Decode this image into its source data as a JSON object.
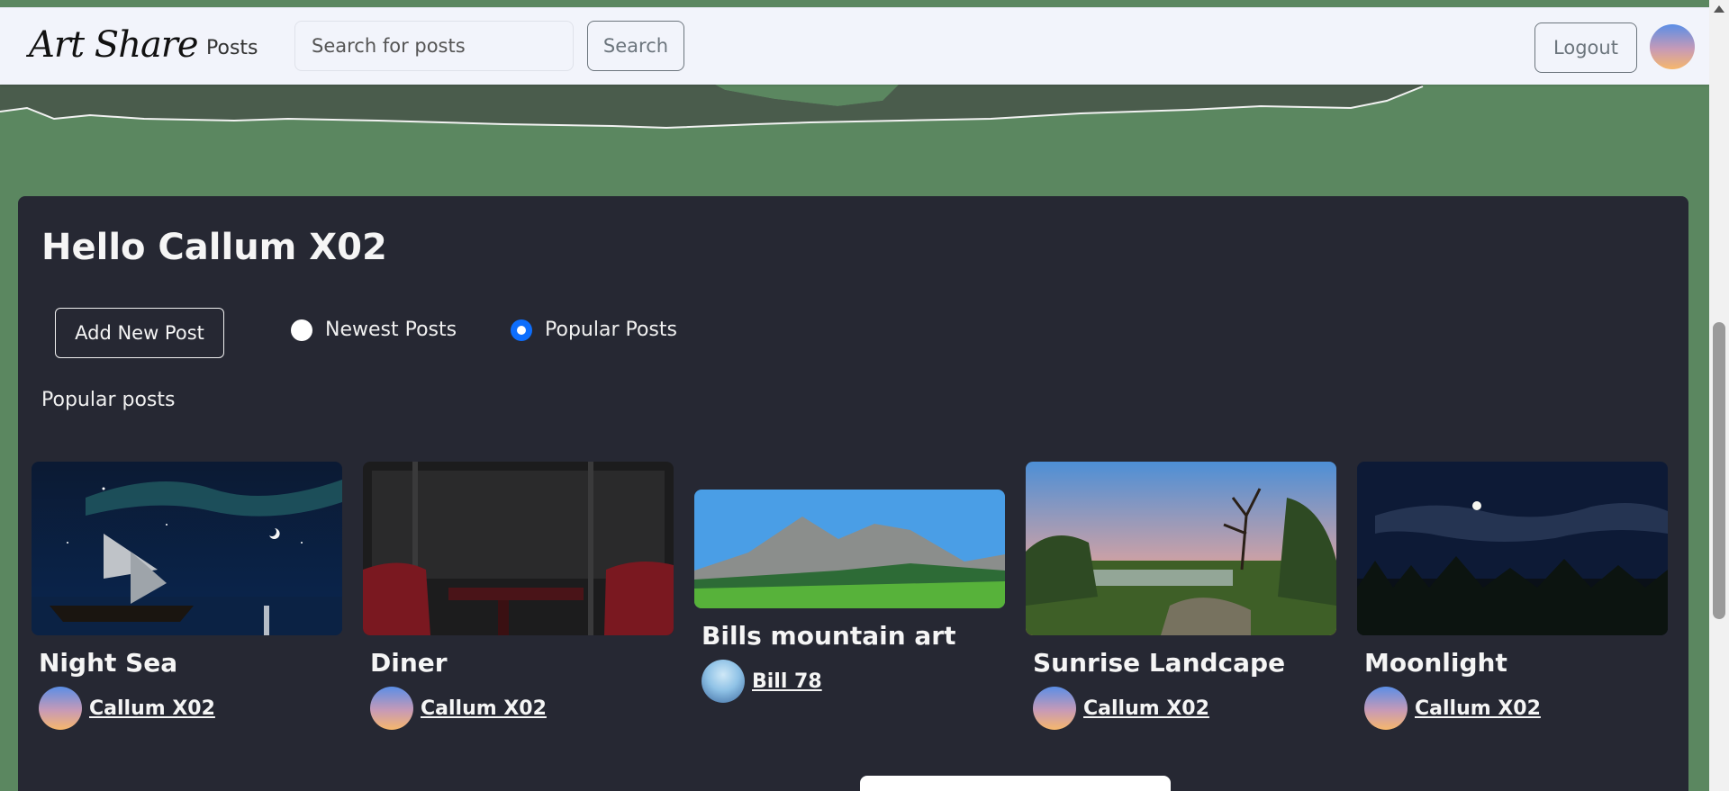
{
  "navbar": {
    "brand": "Art Share",
    "posts_link": "Posts",
    "search_placeholder": "Search for posts",
    "search_button": "Search",
    "logout_button": "Logout"
  },
  "main": {
    "greeting": "Hello Callum X02",
    "add_post_button": "Add New Post",
    "sort_options": [
      {
        "label": "Newest Posts",
        "selected": false
      },
      {
        "label": "Popular Posts",
        "selected": true
      }
    ],
    "section_label": "Popular posts"
  },
  "posts": [
    {
      "title": "Night Sea",
      "author": "Callum X02"
    },
    {
      "title": "Diner",
      "author": "Callum X02"
    },
    {
      "title": "Bills mountain art",
      "author": "Bill 78"
    },
    {
      "title": "Sunrise Landcape",
      "author": "Callum X02"
    },
    {
      "title": "Moonlight",
      "author": "Callum X02"
    }
  ],
  "colors": {
    "page_background": "#5b8760",
    "panel": "#262833",
    "navbar": "#f2f4fb",
    "accent": "#0d6efd"
  }
}
